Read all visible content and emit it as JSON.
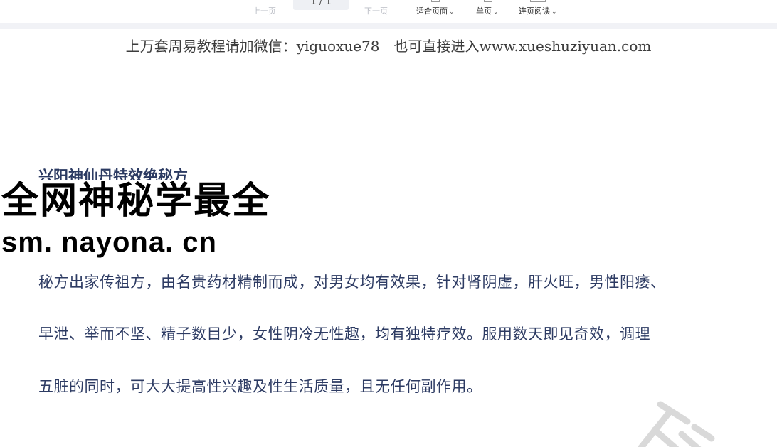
{
  "toolbar": {
    "prev_label": "上一页",
    "page_indicator": "1 / 1",
    "next_label": "下一页",
    "fit_page_label": "适合页面",
    "single_page_label": "单页",
    "continuous_label": "连页阅读"
  },
  "document": {
    "banner": "上万套周易教程请加微信：yiguoxue78　也可直接进入www.xueshuziyuan.com",
    "title": "兴阳神仙丹特效绝秘方",
    "overlay_title": "全网神秘学最全",
    "overlay_url": "sm. nayona. cn",
    "paragraph_lines": [
      "秘方出家传祖方，由名贵药材精制而成，对男女均有效果，针对肾阴虚，肝火旺，男性阳痿、",
      "早泄、举而不坚、精子数目少，女性阴冷无性趣，均有独特疗效。服用数天即见奇效，调理",
      "五脏的同时，可大大提高性兴趣及性生活质量，且无任何副作用。"
    ]
  },
  "colors": {
    "body_text": "#2d3b63",
    "banner_text": "#3c3c3c",
    "overlay_text": "#000000",
    "toolbar_bg": "#ffffff",
    "gap_band": "#f1f2f6"
  }
}
